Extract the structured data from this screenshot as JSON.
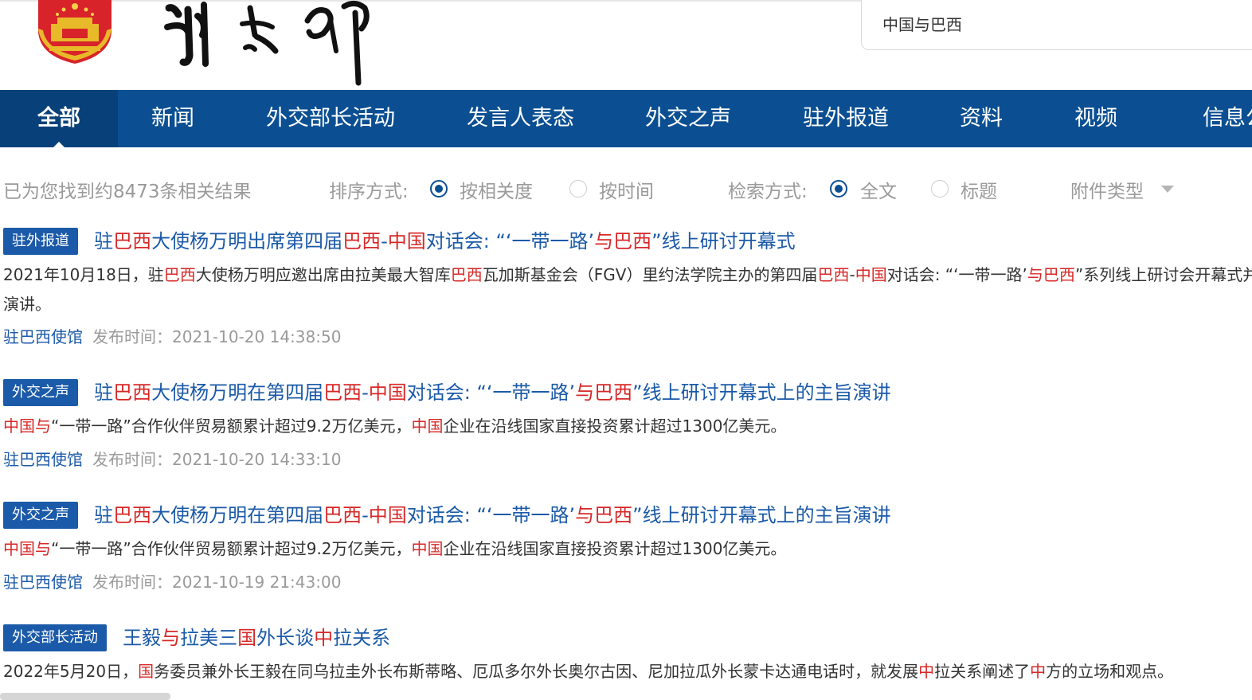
{
  "search": {
    "query": "中国与巴西"
  },
  "nav": {
    "items": [
      {
        "label": "全部",
        "active": true
      },
      {
        "label": "新闻"
      },
      {
        "label": "外交部长活动"
      },
      {
        "label": "发言人表态"
      },
      {
        "label": "外交之声"
      },
      {
        "label": "驻外报道"
      },
      {
        "label": "资料"
      },
      {
        "label": "视频"
      },
      {
        "label": "信息公开"
      }
    ]
  },
  "filters": {
    "result_count": "已为您找到约8473条相关结果",
    "sort_label": "排序方式:",
    "sort_relevance": "按相关度",
    "sort_time": "按时间",
    "mode_label": "检索方式:",
    "mode_fulltext": "全文",
    "mode_title": "标题",
    "attachment_type": "附件类型"
  },
  "results": [
    {
      "badge": "驻外报道",
      "title": [
        {
          "t": "驻"
        },
        {
          "t": "巴西",
          "hl": true
        },
        {
          "t": "大使杨万明出席第四届"
        },
        {
          "t": "巴西",
          "hl": true
        },
        {
          "t": "-"
        },
        {
          "t": "中国",
          "hl": true
        },
        {
          "t": "对话会: “‘一带一路’"
        },
        {
          "t": "与巴西",
          "hl": true
        },
        {
          "t": "”线上研讨开幕式"
        }
      ],
      "snippet_lines": [
        [
          {
            "t": "2021年10月18日，驻"
          },
          {
            "t": "巴西",
            "hl": true
          },
          {
            "t": "大使杨万明应邀出席由拉美最大智库"
          },
          {
            "t": "巴西",
            "hl": true
          },
          {
            "t": "瓦加斯基金会（FGV）里约法学院主办的第四届"
          },
          {
            "t": "巴西",
            "hl": true
          },
          {
            "t": "-"
          },
          {
            "t": "中国",
            "hl": true
          },
          {
            "t": "对话会: “‘一带一路’"
          },
          {
            "t": "与巴西",
            "hl": true
          },
          {
            "t": "”系列线上研讨会开幕式并发表主旨"
          }
        ],
        [
          {
            "t": "演讲。"
          }
        ]
      ],
      "source": "驻巴西使馆",
      "time_label": "发布时间：",
      "time": "2021-10-20 14:38:50"
    },
    {
      "badge": "外交之声",
      "title": [
        {
          "t": "驻"
        },
        {
          "t": "巴西",
          "hl": true
        },
        {
          "t": "大使杨万明在第四届"
        },
        {
          "t": "巴西",
          "hl": true
        },
        {
          "t": "-"
        },
        {
          "t": "中国",
          "hl": true
        },
        {
          "t": "对话会: “‘一带一路’"
        },
        {
          "t": "与巴西",
          "hl": true
        },
        {
          "t": "”线上研讨开幕式上的主旨演讲"
        }
      ],
      "snippet_lines": [
        [
          {
            "t": "中国与",
            "hl": true
          },
          {
            "t": "“一带一路”合作伙伴贸易额累计超过9.2万亿美元，"
          },
          {
            "t": "中国",
            "hl": true
          },
          {
            "t": "企业在沿线国家直接投资累计超过1300亿美元。"
          }
        ]
      ],
      "source": "驻巴西使馆",
      "time_label": "发布时间：",
      "time": "2021-10-20 14:33:10"
    },
    {
      "badge": "外交之声",
      "title": [
        {
          "t": "驻"
        },
        {
          "t": "巴西",
          "hl": true
        },
        {
          "t": "大使杨万明在第四届"
        },
        {
          "t": "巴西",
          "hl": true
        },
        {
          "t": "-"
        },
        {
          "t": "中国",
          "hl": true
        },
        {
          "t": "对话会: “‘一带一路’"
        },
        {
          "t": "与巴西",
          "hl": true
        },
        {
          "t": "”线上研讨开幕式上的主旨演讲"
        }
      ],
      "snippet_lines": [
        [
          {
            "t": "中国与",
            "hl": true
          },
          {
            "t": "“一带一路”合作伙伴贸易额累计超过9.2万亿美元，"
          },
          {
            "t": "中国",
            "hl": true
          },
          {
            "t": "企业在沿线国家直接投资累计超过1300亿美元。"
          }
        ]
      ],
      "source": "驻巴西使馆",
      "time_label": "发布时间：",
      "time": "2021-10-19 21:43:00"
    },
    {
      "badge": "外交部长活动",
      "title": [
        {
          "t": "王毅"
        },
        {
          "t": "与",
          "hl": true
        },
        {
          "t": "拉美三"
        },
        {
          "t": "国",
          "hl": true
        },
        {
          "t": "外长谈"
        },
        {
          "t": "中",
          "hl": true
        },
        {
          "t": "拉关系"
        }
      ],
      "snippet_lines": [
        [
          {
            "t": "2022年5月20日，"
          },
          {
            "t": "国",
            "hl": true
          },
          {
            "t": "务委员兼外长王毅在同乌拉圭外长布斯蒂略、厄瓜多尔外长奥尔古因、尼加拉瓜外长蒙卡达通电话时，就发展"
          },
          {
            "t": "中",
            "hl": true
          },
          {
            "t": "拉关系阐述了"
          },
          {
            "t": "中",
            "hl": true
          },
          {
            "t": "方的立场和观点。"
          }
        ]
      ],
      "source": "",
      "time_label": "",
      "time": ""
    }
  ]
}
